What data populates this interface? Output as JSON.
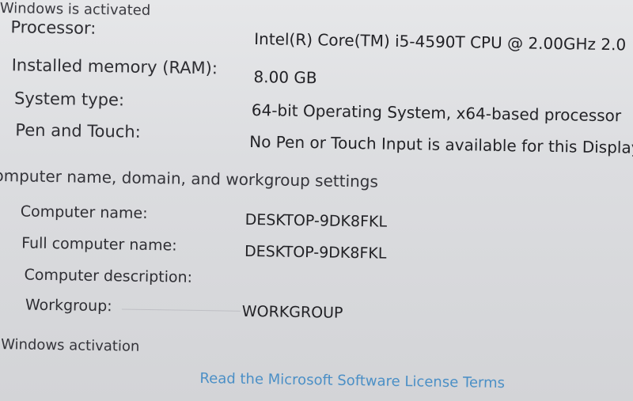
{
  "system": {
    "processor_label": "Processor:",
    "processor_value": "Intel(R) Core(TM) i5-4590T CPU @ 2.00GHz   2.0",
    "memory_label": "Installed memory (RAM):",
    "memory_value": "8.00 GB",
    "type_label": "System type:",
    "type_value": "64-bit Operating System, x64-based processor",
    "pen_label": "Pen and Touch:",
    "pen_value": "No Pen or Touch Input is available for this Display"
  },
  "computer": {
    "section_title": "omputer name, domain, and workgroup settings",
    "name_label": "Computer name:",
    "name_value": "DESKTOP-9DK8FKL",
    "full_name_label": "Full computer name:",
    "full_name_value": "DESKTOP-9DK8FKL",
    "description_label": "Computer description:",
    "workgroup_label": "Workgroup:",
    "workgroup_value": "WORKGROUP"
  },
  "activation": {
    "section_title": "Windows activation",
    "status": "Windows is activated",
    "license_link": "Read the Microsoft Software License Terms"
  }
}
